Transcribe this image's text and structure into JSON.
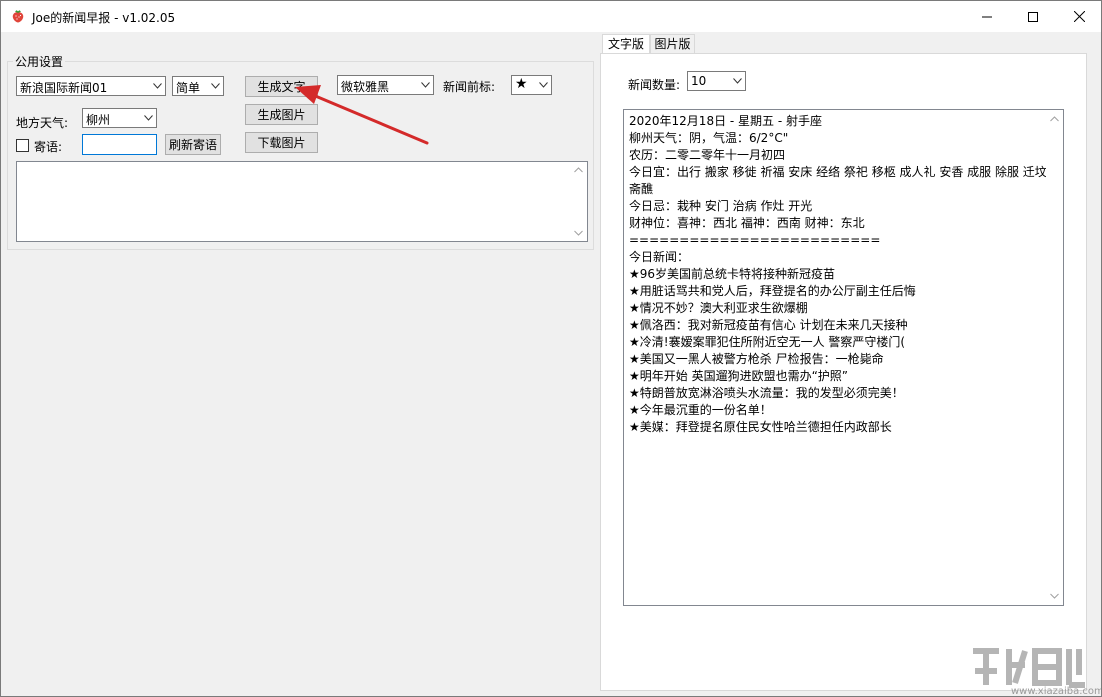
{
  "window": {
    "title": "Joe的新闻早报 - v1.02.05"
  },
  "settings": {
    "group_title": "公用设置",
    "source_select": "新浪国际新闻01",
    "script_select": "简单",
    "generate_text_button": "生成文字",
    "generate_image_button": "生成图片",
    "download_image_button": "下载图片",
    "font_select": "微软雅黑",
    "prefix_label": "新闻前标:",
    "prefix_select": "★",
    "weather_label": "地方天气:",
    "city_select": "柳州",
    "greeting_label": "寄语:",
    "greeting_value": "",
    "refresh_greeting_button": "刷新寄语",
    "greeting_checked": false
  },
  "tabs": [
    {
      "label": "文字版",
      "active": true
    },
    {
      "label": "图片版",
      "active": false
    }
  ],
  "text_tab": {
    "count_label": "新闻数量:",
    "count_select": "10",
    "output_text": "2020年12月18日 - 星期五 - 射手座\n柳州天气：阴，气温：6/2°C\"\n农历：二零二零年十一月初四\n今日宜：出行 搬家 移徙 祈福 安床 经络 祭祀 移柩 成人礼 安香 成服 除服 迁坟 斋醮\n今日忌：栽种 安门 治病 作灶 开光\n财神位：喜神：西北 福神：西南 财神：东北\n=========================\n今日新闻：\n★96岁美国前总统卡特将接种新冠疫苗\n★用脏话骂共和党人后，拜登提名的办公厅副主任后悔\n★情况不妙？澳大利亚求生欲爆棚\n★佩洛西：我对新冠疫苗有信心 计划在未来几天接种\n★冷清!褰嫒案罪犯住所附近空无一人 警察严守楼门(\n★美国又一黑人被警方枪杀 尸检报告：一枪毙命\n★明年开始 英国遛狗进欧盟也需办“护照”\n★特朗普放宽淋浴喷头水流量：我的发型必须完美！\n★今年最沉重的一份名单！\n★美媒：拜登提名原住民女性哈兰德担任内政部长"
  },
  "watermark": {
    "text": "www.xiazaiba.com"
  },
  "colors": {
    "annotation_arrow": "#d42a2a",
    "focus_border": "#0078d7"
  }
}
